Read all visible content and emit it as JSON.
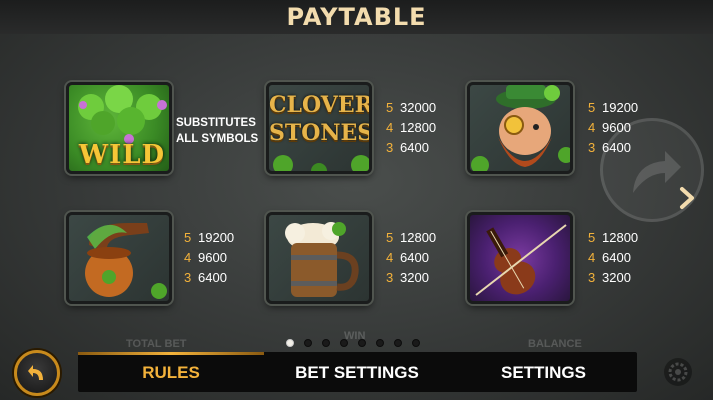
{
  "header": {
    "title": "PAYTABLE"
  },
  "wild": {
    "symbol_label": "WILD",
    "description_line1": "SUBSTITUTES",
    "description_line2": "ALL SYMBOLS"
  },
  "symbols": [
    {
      "name": "clover-stones",
      "label_line1": "CLOVER",
      "label_line2": "STONES",
      "payouts": [
        {
          "k": "5",
          "v": "32000"
        },
        {
          "k": "4",
          "v": "12800"
        },
        {
          "k": "3",
          "v": "6400"
        }
      ]
    },
    {
      "name": "leprechaun",
      "payouts": [
        {
          "k": "5",
          "v": "19200"
        },
        {
          "k": "4",
          "v": "9600"
        },
        {
          "k": "3",
          "v": "6400"
        }
      ]
    },
    {
      "name": "pipe",
      "payouts": [
        {
          "k": "5",
          "v": "19200"
        },
        {
          "k": "4",
          "v": "9600"
        },
        {
          "k": "3",
          "v": "6400"
        }
      ]
    },
    {
      "name": "beer-mug",
      "payouts": [
        {
          "k": "5",
          "v": "12800"
        },
        {
          "k": "4",
          "v": "6400"
        },
        {
          "k": "3",
          "v": "3200"
        }
      ]
    },
    {
      "name": "violin",
      "payouts": [
        {
          "k": "5",
          "v": "12800"
        },
        {
          "k": "4",
          "v": "6400"
        },
        {
          "k": "3",
          "v": "3200"
        }
      ]
    }
  ],
  "pager": {
    "pages": 8,
    "current": 1
  },
  "background_labels": {
    "total_bet": "TOTAL BET",
    "win": "WIN",
    "balance": "BALANCE"
  },
  "tabs": [
    {
      "label": "RULES",
      "active": true
    },
    {
      "label": "BET SETTINGS",
      "active": false
    },
    {
      "label": "SETTINGS",
      "active": false
    }
  ],
  "colors": {
    "accent": "#f3b23b",
    "title": "#f3dcae",
    "nav_bg": "#0b0b0b"
  },
  "icons": {
    "back": "back-arrow-icon",
    "next": "chevron-right-icon",
    "settings": "gear-icon"
  }
}
